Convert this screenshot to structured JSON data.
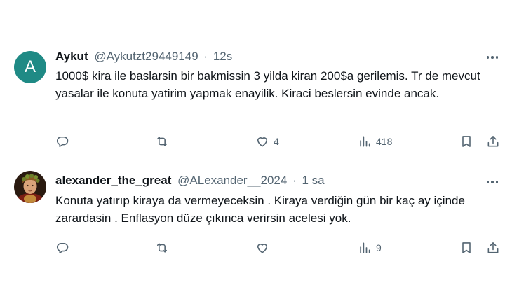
{
  "tweets": [
    {
      "avatar_letter": "A",
      "display_name": "Aykut",
      "handle": "@Aykutzt29449149",
      "separator": "·",
      "time": "12s",
      "text": "1000$ kira ile baslarsin bir bakmissin 3 yilda kiran 200$a gerilemis. Tr de mevcut yasalar ile konuta yatirim yapmak enayilik. Kiraci beslersin evinde ancak.",
      "reply_count": "",
      "retweet_count": "",
      "like_count": "4",
      "view_count": "418"
    },
    {
      "avatar_icon": "portrait-avatar",
      "display_name": "alexander_the_great",
      "handle": "@ALexander__2024",
      "separator": "·",
      "time": "1 sa",
      "text": "Konuta yatırıp kiraya da vermeyeceksin . Kiraya verdiğin gün bir kaç ay içinde zarardasin . Enflasyon düze çıkınca verirsin acelesi yok.",
      "reply_count": "",
      "retweet_count": "",
      "like_count": "",
      "view_count": "9"
    }
  ],
  "icons": {
    "reply": "reply-icon",
    "retweet": "retweet-icon",
    "like": "heart-icon",
    "views": "views-icon",
    "bookmark": "bookmark-icon",
    "share": "share-icon",
    "more": "more-icon"
  },
  "colors": {
    "text_primary": "#0f1419",
    "text_secondary": "#536471",
    "divider": "#eff3f4",
    "avatar_bg": "#1f8a85"
  }
}
